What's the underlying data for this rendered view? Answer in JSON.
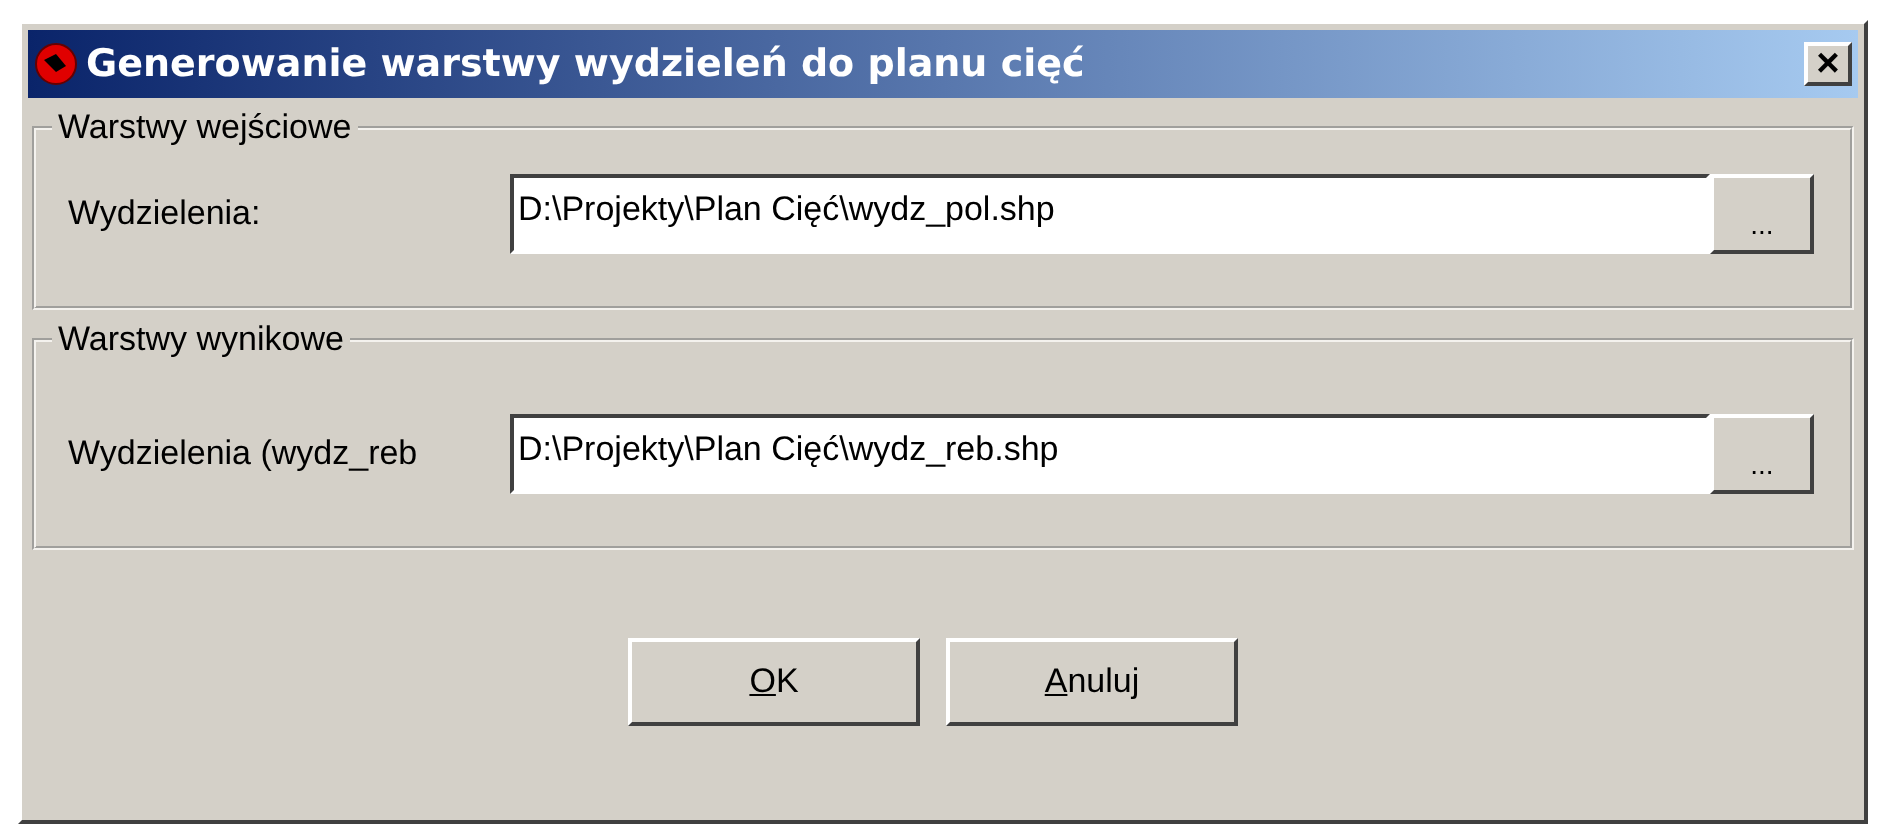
{
  "window": {
    "title": "Generowanie warstwy wydzieleń do planu cięć",
    "close": "×"
  },
  "groups": [
    {
      "title": "Warstwy wejściowe",
      "label": "Wydzielenia:",
      "value": "D:\\Projekty\\Plan Cięć\\wydz_pol.shp",
      "browse": "..."
    },
    {
      "title": "Warstwy wynikowe",
      "label": "Wydzielenia (wydz_reb",
      "value": "D:\\Projekty\\Plan Cięć\\wydz_reb.shp",
      "browse": "..."
    }
  ],
  "buttons": [
    {
      "mnemonic": "O",
      "rest": "K"
    },
    {
      "mnemonic": "A",
      "rest": "nuluj"
    }
  ]
}
